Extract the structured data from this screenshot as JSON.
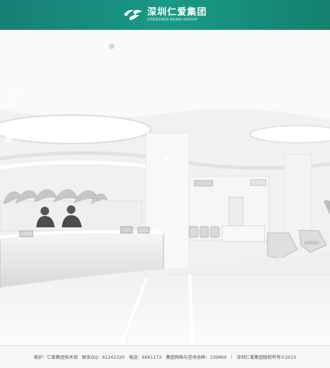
{
  "header": {
    "brand_cn": "深圳仁爱集团",
    "brand_en": "SHENZHEN RENAI GROUP",
    "colors": {
      "gradient_left": "#177f73",
      "gradient_center": "#199a86",
      "gradient_right": "#14806f"
    },
    "logo_icon": "renai-logo-icon"
  },
  "scene": {
    "icon": "hospital-lobby-photo"
  },
  "footer": {
    "maintainer": "维护：仁爱集团技术部",
    "qq": "联系QQ：61242320",
    "phone": "电话：6661173",
    "consult_group": "集团网络与咨询总群：109860",
    "separator": "|",
    "copyright": "深圳仁爱集团版权所有©2015"
  }
}
